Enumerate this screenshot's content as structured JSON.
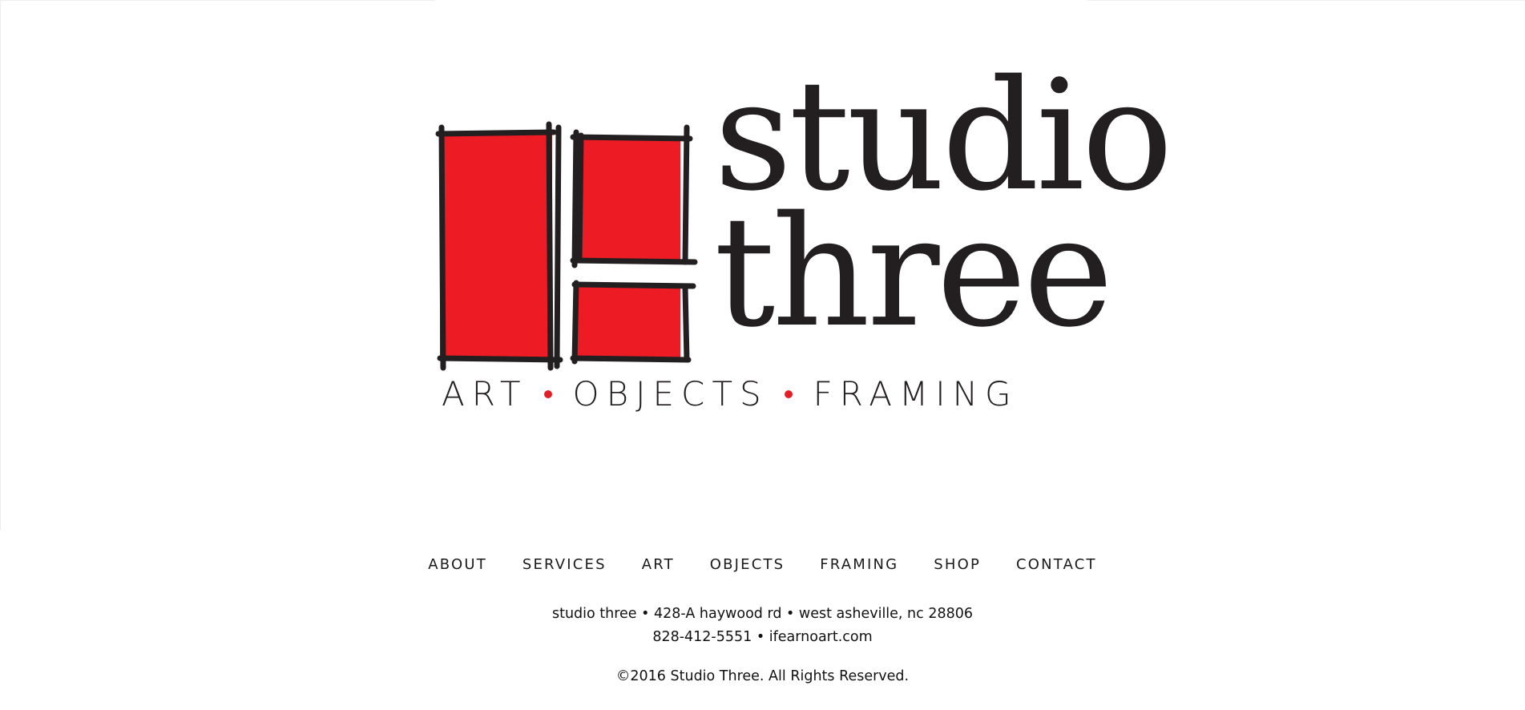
{
  "logo": {
    "word_line1": "studio",
    "word_line2": "three",
    "tagline": [
      "ART",
      "OBJECTS",
      "FRAMING"
    ],
    "accent_color": "#e31e26",
    "ink_color": "#231f20"
  },
  "nav": {
    "items": [
      {
        "label": "ABOUT"
      },
      {
        "label": "SERVICES"
      },
      {
        "label": "ART"
      },
      {
        "label": "OBJECTS"
      },
      {
        "label": "FRAMING"
      },
      {
        "label": "SHOP"
      },
      {
        "label": "CONTACT"
      }
    ]
  },
  "footer": {
    "address_line": "studio three • 428-A haywood rd • west asheville, nc 28806",
    "contact_phone": "828-412-5551",
    "contact_separator": " • ",
    "contact_web": "ifearnoart.com",
    "copyright": "©2016 Studio Three. All Rights Reserved."
  }
}
